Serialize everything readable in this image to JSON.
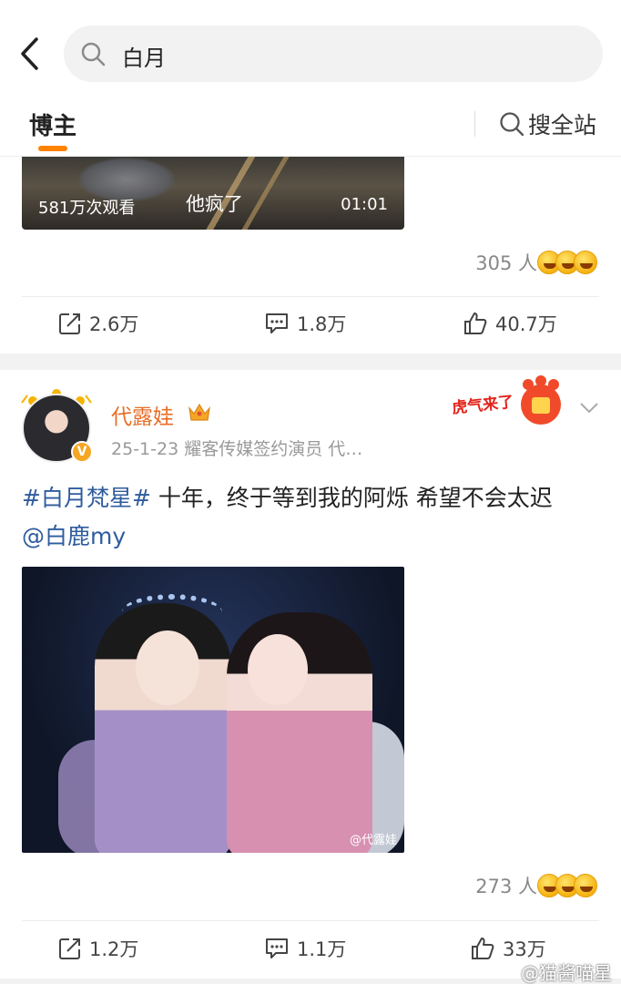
{
  "search": {
    "query": "白月"
  },
  "tabs": {
    "blog_label": "博主",
    "search_all_label": "搜全站"
  },
  "card1": {
    "video": {
      "views": "581万次观看",
      "caption": "他疯了",
      "duration": "01:01"
    },
    "reactions": {
      "count": "305 人",
      "emojis": [
        "grin-emoji",
        "laugh-emoji",
        "shock-emoji"
      ]
    },
    "actions": {
      "repost": "2.6万",
      "comment": "1.8万",
      "like": "40.7万"
    }
  },
  "card2": {
    "author": {
      "name": "代露娃",
      "meta": "25-1-23  耀客传媒签约演员 代…",
      "verified_badge": "V"
    },
    "sticker_text": "虎气来了",
    "post": {
      "hashtag": "#白月梵星#",
      "text": " 十年，终于等到我的阿烁 希望不会太迟",
      "mention": "@白鹿my"
    },
    "image_watermark": "@代露娃",
    "reactions": {
      "count": "273 人",
      "emojis": [
        "grin-emoji",
        "laugh-emoji",
        "smirk-emoji"
      ]
    },
    "actions": {
      "repost": "1.2万",
      "comment": "1.1万",
      "like": "33万"
    }
  },
  "overlay_watermark": "@猫酱喵星",
  "colors": {
    "accent_orange": "#ff8200",
    "username_orange": "#e86e28",
    "link_blue": "#2f5c9e",
    "divider_gray": "#ececec"
  }
}
